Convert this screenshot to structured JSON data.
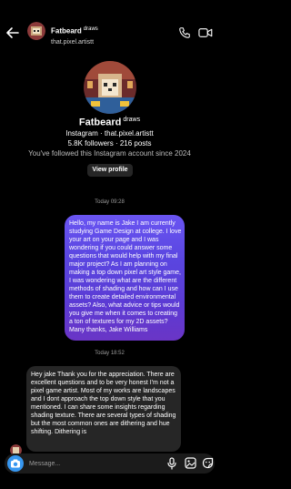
{
  "header": {
    "display_name": "Fatbeard",
    "name_suffix": "draws",
    "username": "that.pixel.artistt"
  },
  "profile": {
    "display_name": "Fatbeard",
    "name_suffix": "draws",
    "platform_line": "Instagram · that.pixel.artistt",
    "stats_line": "5.8K followers · 216 posts",
    "follow_note": "You've followed this Instagram account since 2024",
    "view_profile_label": "View profile"
  },
  "messages": [
    {
      "timestamp": "Today 09:28",
      "direction": "outgoing",
      "text": "Hello, my name is Jake I am currently studying Game Design at college. I love your art on your page and I was wondering if you could answer some questions that would help with my final major project? As I am planning on making a top down pixel art style game, I was wondering what are the different methods of shading and how can I use them to create detailed environmental assets? Also, what advice or tips would you give me when it comes to creating a ton of textures for my 2D assets? Many thanks, Jake Williams"
    },
    {
      "timestamp": "Today 18:52",
      "direction": "incoming",
      "text": "Hey jake Thank you for the appreciation. There are excellent questions and to be very honest I'm not a pixel game artist. Most of my works are landscapes and I dont approach the top down style that you mentioned. I can share some insights regarding shading texture. There are several types of shading but the most common ones are dithering and hue shifting. Dithering is"
    }
  ],
  "composer": {
    "placeholder": "Message..."
  },
  "colors": {
    "background": "#000000",
    "outgoing_bubble": "#5b46e0",
    "incoming_bubble": "#262626",
    "accent": "#3797f0"
  },
  "icons": [
    "back-arrow-icon",
    "phone-icon",
    "video-call-icon",
    "camera-icon",
    "microphone-icon",
    "gallery-icon",
    "sticker-icon"
  ]
}
